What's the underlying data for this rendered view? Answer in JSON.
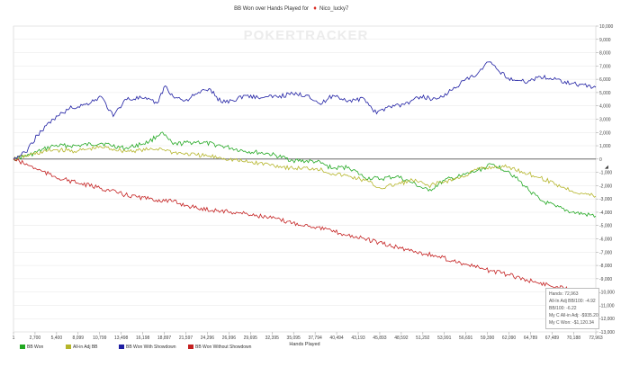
{
  "chart_data": {
    "type": "line",
    "title_prefix": "BB Won over Hands Played for",
    "player_name": "Nico_lucky7",
    "watermark": "POKERTRACKER",
    "xlabel": "Hands Played",
    "ylabel": "",
    "xlim": [
      1,
      72963
    ],
    "ylim": [
      -13000,
      10000
    ],
    "x_ticks": [
      "1",
      "2,700",
      "5,400",
      "8,099",
      "10,799",
      "13,498",
      "16,198",
      "18,897",
      "21,597",
      "24,296",
      "26,996",
      "29,695",
      "32,395",
      "35,095",
      "37,794",
      "40,494",
      "43,193",
      "45,893",
      "48,592",
      "51,292",
      "53,991",
      "56,691",
      "59,390",
      "62,090",
      "64,789",
      "67,489",
      "70,188",
      "72,963"
    ],
    "y_ticks": [
      "10,000",
      "9,000",
      "8,000",
      "7,000",
      "6,000",
      "5,000",
      "4,000",
      "3,000",
      "2,000",
      "1,000",
      "0",
      "-1,000",
      "-2,000",
      "-3,000",
      "-4,000",
      "-5,000",
      "-6,000",
      "-7,000",
      "-8,000",
      "-9,000",
      "-10,000",
      "-11,000",
      "-12,000",
      "-13,000"
    ],
    "series": [
      {
        "name": "BB Won",
        "color": "#22a822",
        "x": [
          0,
          2000,
          5000,
          8000,
          11000,
          14000,
          17000,
          18500,
          20000,
          23000,
          26000,
          29000,
          32000,
          35000,
          38000,
          40000,
          42000,
          44000,
          46000,
          48000,
          50000,
          52000,
          54000,
          56000,
          58000,
          60000,
          62000,
          64000,
          66000,
          68000,
          70000,
          72963
        ],
        "y": [
          0,
          300,
          1000,
          1000,
          1200,
          800,
          1300,
          2000,
          1100,
          1300,
          1000,
          600,
          400,
          -100,
          -200,
          -700,
          -600,
          -1400,
          -1500,
          -1300,
          -1800,
          -2400,
          -1600,
          -1300,
          -900,
          -400,
          -900,
          -2000,
          -3100,
          -3600,
          -4000,
          -4300
        ]
      },
      {
        "name": "All-in Adj BB",
        "color": "#b5b52a",
        "x": [
          0,
          2000,
          5000,
          8000,
          11000,
          14000,
          17000,
          18500,
          20000,
          23000,
          26000,
          29000,
          32000,
          35000,
          38000,
          40000,
          42000,
          44000,
          46000,
          48000,
          50000,
          52000,
          54000,
          56000,
          58000,
          60000,
          62000,
          64000,
          66000,
          68000,
          70000,
          72963
        ],
        "y": [
          0,
          300,
          700,
          600,
          900,
          600,
          700,
          800,
          500,
          300,
          100,
          -200,
          -400,
          -700,
          -700,
          -1100,
          -1300,
          -1600,
          -2200,
          -1900,
          -1600,
          -2000,
          -1700,
          -1400,
          -800,
          -600,
          -600,
          -1000,
          -1400,
          -1900,
          -2400,
          -2800
        ]
      },
      {
        "name": "BB Won With Showdown",
        "color": "#1f1fa3",
        "x": [
          0,
          1500,
          3000,
          5000,
          7000,
          9000,
          11000,
          12500,
          14000,
          16000,
          18000,
          19000,
          20000,
          21500,
          23000,
          24500,
          26000,
          27500,
          29000,
          31000,
          33000,
          35000,
          37000,
          38500,
          40000,
          42000,
          44000,
          45500,
          47000,
          49000,
          51000,
          53000,
          55000,
          56500,
          58000,
          59500,
          60500,
          62000,
          64000,
          66000,
          68000,
          70000,
          72963
        ],
        "y": [
          0,
          500,
          1800,
          3000,
          3800,
          4100,
          4700,
          3200,
          4500,
          4600,
          4200,
          5500,
          4700,
          4400,
          4900,
          5300,
          4300,
          4400,
          4800,
          4600,
          4700,
          4900,
          4800,
          4100,
          4800,
          4400,
          4500,
          3400,
          4000,
          4100,
          4700,
          4500,
          5200,
          5900,
          6300,
          7300,
          6800,
          6100,
          5800,
          6200,
          6000,
          5700,
          5400
        ]
      },
      {
        "name": "BB Won Without Showdown",
        "color": "#c42020",
        "x": [
          0,
          2000,
          5000,
          8000,
          11000,
          14000,
          17000,
          20000,
          23000,
          26000,
          29000,
          32000,
          35000,
          38000,
          41000,
          44000,
          47000,
          50000,
          53000,
          56000,
          59000,
          62000,
          65000,
          68000,
          70000,
          72963
        ],
        "y": [
          0,
          -500,
          -1300,
          -1800,
          -2200,
          -2700,
          -3000,
          -3200,
          -3700,
          -3900,
          -4100,
          -4400,
          -4800,
          -5100,
          -5600,
          -6000,
          -6500,
          -6900,
          -7300,
          -7800,
          -8300,
          -8700,
          -9200,
          -9600,
          -9800,
          -9900
        ]
      }
    ],
    "stats": [
      "Hands: 72,963",
      "All-In Adj BB/100: -4.92",
      "BB/100: -6.22",
      "My C All-in Adj: -$935.20",
      "My C Won: -$1,120.34"
    ]
  }
}
